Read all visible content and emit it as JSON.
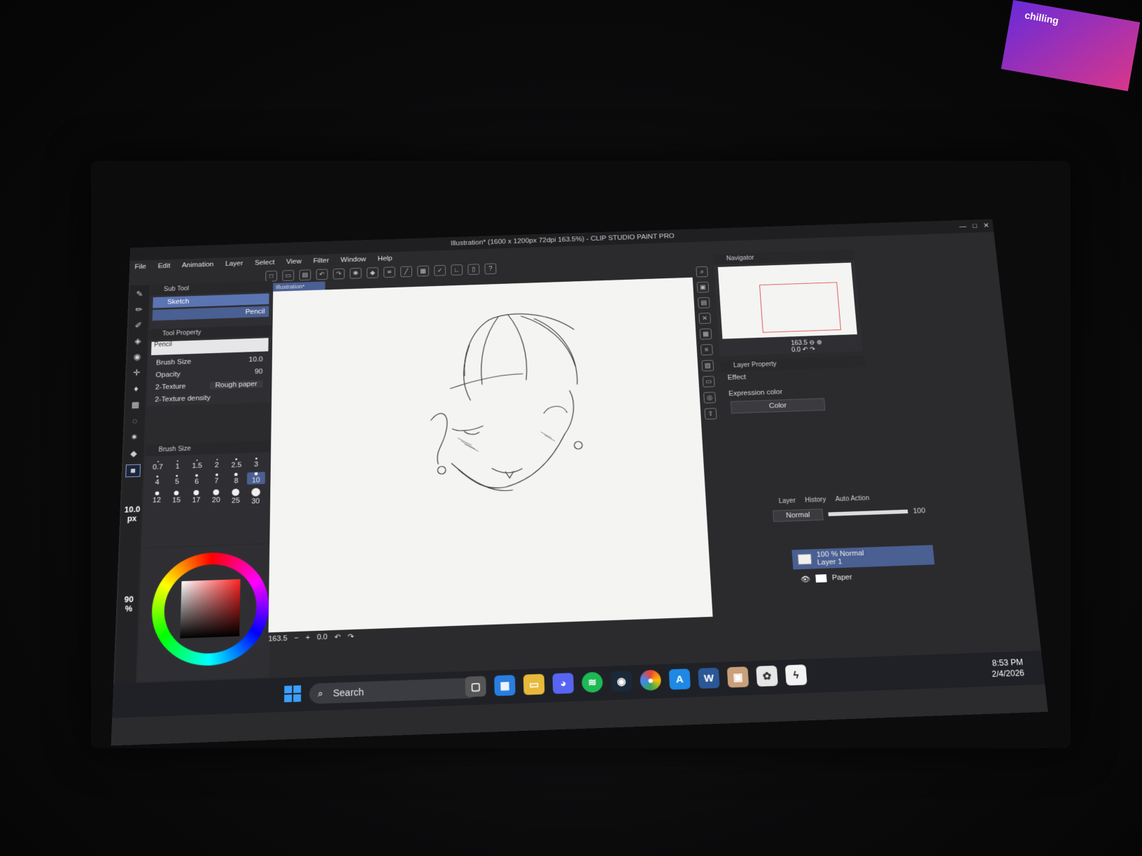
{
  "window": {
    "title": "Illustration* (1600 x 1200px 72dpi 163.5%) - CLIP STUDIO PAINT PRO",
    "controls": [
      "—",
      "□",
      "✕"
    ]
  },
  "menu": [
    "File",
    "Edit",
    "Animation",
    "Layer",
    "Select",
    "View",
    "Filter",
    "Window",
    "Help"
  ],
  "sub_tool": {
    "header": "Sub Tool",
    "group": "Sketch",
    "selected_tool": "Pencil"
  },
  "tool_property": {
    "header": "Tool Property",
    "preview_label": "Pencil",
    "brush_size_label": "Brush Size",
    "brush_size_value": "10.0",
    "opacity_label": "Opacity",
    "opacity_value": "90",
    "texture_label": "2-Texture",
    "texture_value": "Rough paper",
    "texture_density_label": "2-Texture density"
  },
  "brush_size_panel": {
    "header": "Brush Size",
    "sizes": [
      "0.7",
      "1",
      "1.5",
      "2",
      "2.5",
      "3",
      "4",
      "5",
      "6",
      "7",
      "8",
      "10",
      "12",
      "15",
      "17",
      "20",
      "25",
      "30"
    ],
    "selected": "10"
  },
  "left_values": {
    "size": "10.0",
    "size_unit": "px",
    "opacity": "90",
    "opacity_unit": "%"
  },
  "canvas": {
    "tab": "Illustration*"
  },
  "status": {
    "zoom": "163.5",
    "angle": "0.0"
  },
  "navigator": {
    "header": "Navigator",
    "zoom": "163.5",
    "rotation": "0.0"
  },
  "layer_property": {
    "header": "Layer Property",
    "effect_label": "Effect",
    "expression_label": "Expression color",
    "expression_value": "Color"
  },
  "layer_panel": {
    "tabs": [
      "Layer",
      "History",
      "Auto Action"
    ],
    "blend_mode": "Normal",
    "opacity": "100",
    "layers": [
      {
        "line1": "100 % Normal",
        "line2": "Layer 1"
      },
      {
        "line1": "",
        "line2": "Paper"
      }
    ]
  },
  "taskbar": {
    "search": "Search",
    "time": "8:53 PM",
    "date": "2/4/2026"
  },
  "sticker_text": "chilling",
  "colors": {
    "accent": "#4a5f92",
    "panel": "#2f2f33",
    "canvas": "#f4f4f2"
  }
}
